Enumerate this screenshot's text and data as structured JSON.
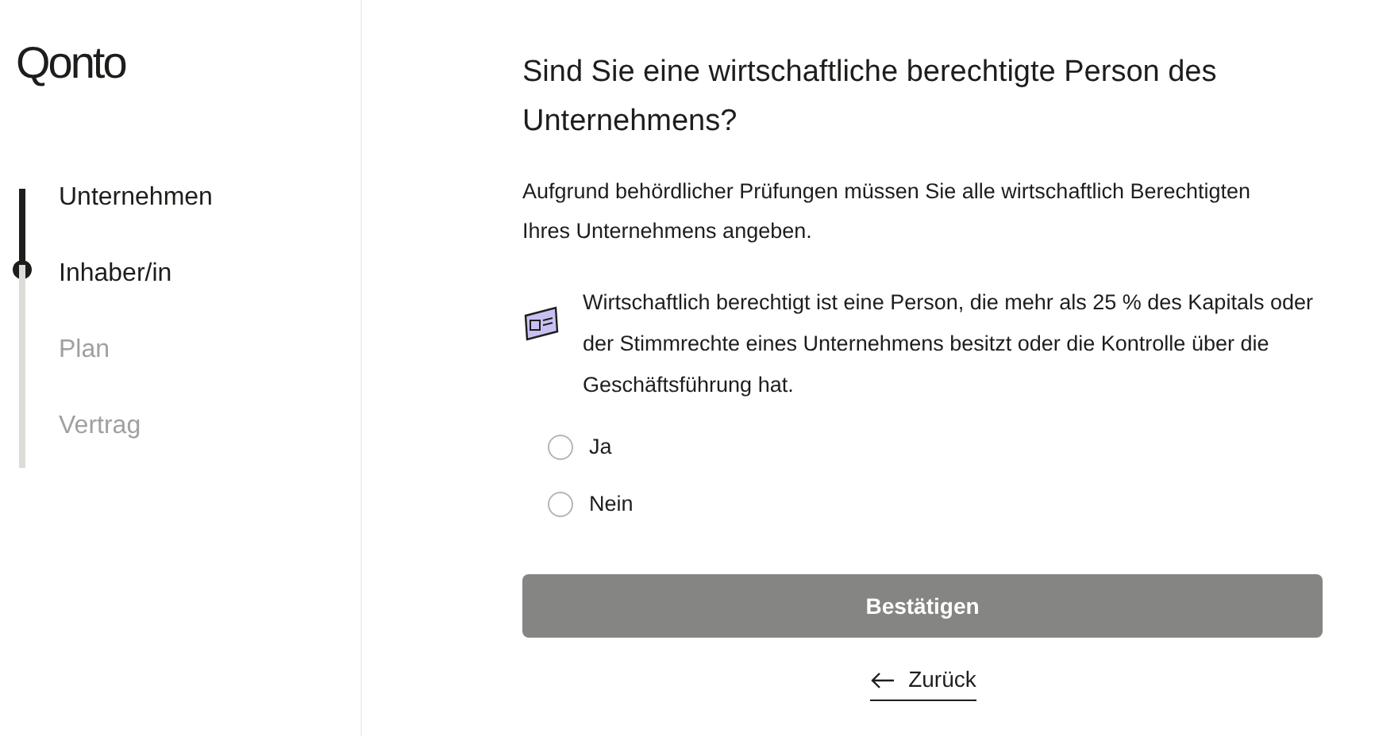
{
  "logo": "Qonto",
  "steps": [
    {
      "label": "Unternehmen",
      "completed": true,
      "current": false
    },
    {
      "label": "Inhaber/in",
      "completed": false,
      "current": true
    },
    {
      "label": "Plan",
      "completed": false,
      "current": false
    },
    {
      "label": "Vertrag",
      "completed": false,
      "current": false
    }
  ],
  "title": "Sind Sie eine wirtschaftliche berechtigte Person des Unternehmens?",
  "description": "Aufgrund behördlicher Prüfungen müssen Sie alle wirtschaftlich Berechtigten Ihres Unternehmens angeben.",
  "info": "Wirtschaftlich berechtigt ist eine Person, die mehr als 25 % des Kapitals oder der Stimmrechte eines Unternehmens besitzt oder die Kontrolle über die Geschäftsführung hat.",
  "options": [
    {
      "label": "Ja",
      "selected": false
    },
    {
      "label": "Nein",
      "selected": false
    }
  ],
  "confirm_button": {
    "label": "Bestätigen",
    "disabled": true
  },
  "back_link": {
    "label": "Zurück"
  }
}
